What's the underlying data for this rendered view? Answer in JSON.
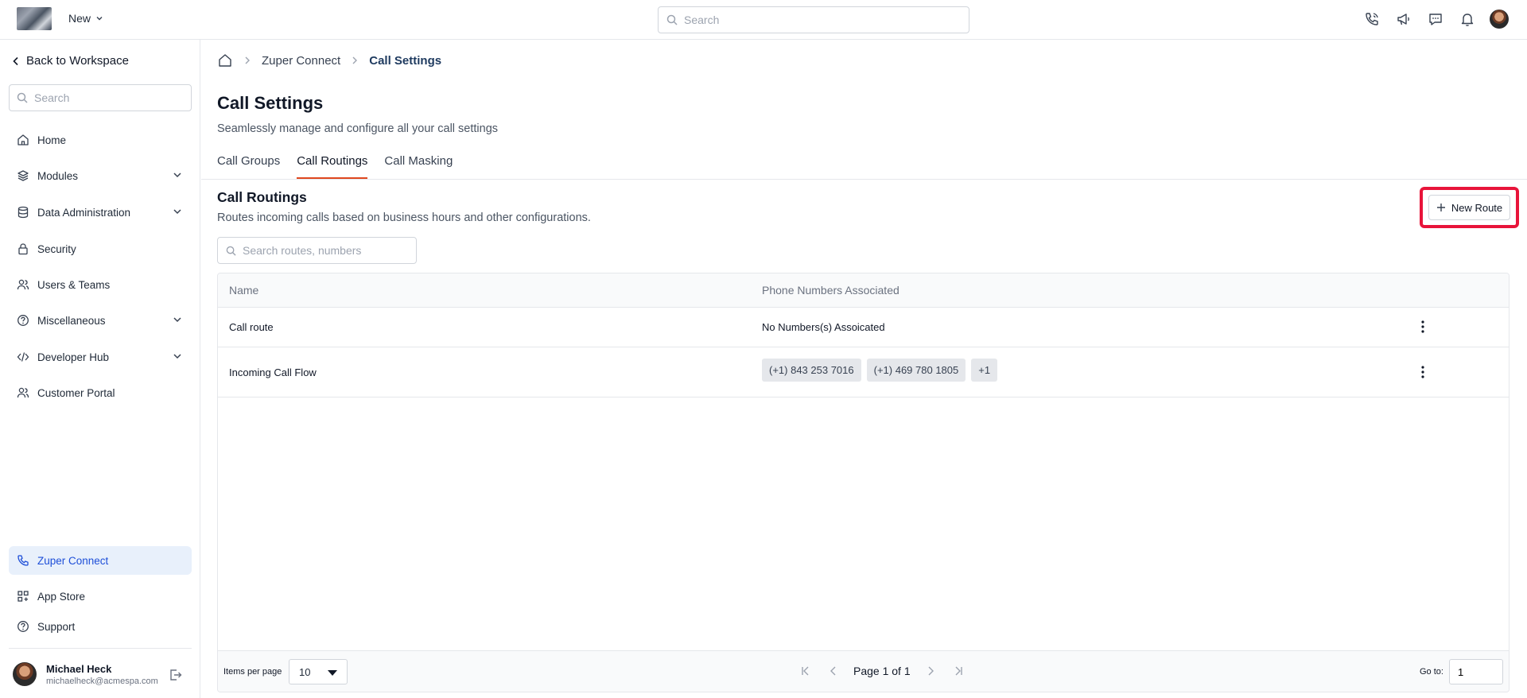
{
  "topbar": {
    "new_label": "New",
    "search_placeholder": "Search",
    "icons": [
      "phone-call-icon",
      "megaphone-icon",
      "chat-icon",
      "bell-icon",
      "user-avatar"
    ]
  },
  "sidebar": {
    "back_label": "Back to Workspace",
    "search_placeholder": "Search",
    "items": [
      {
        "label": "Home",
        "icon": "home-icon",
        "expandable": false
      },
      {
        "label": "Modules",
        "icon": "layers-icon",
        "expandable": true
      },
      {
        "label": "Data Administration",
        "icon": "database-icon",
        "expandable": true
      },
      {
        "label": "Security",
        "icon": "lock-icon",
        "expandable": false
      },
      {
        "label": "Users & Teams",
        "icon": "users-icon",
        "expandable": false
      },
      {
        "label": "Miscellaneous",
        "icon": "help-circle-icon",
        "expandable": true
      },
      {
        "label": "Developer Hub",
        "icon": "code-icon",
        "expandable": true
      },
      {
        "label": "Customer Portal",
        "icon": "users-icon",
        "expandable": false
      }
    ],
    "bottom_items": [
      {
        "label": "Zuper Connect",
        "icon": "phone-icon",
        "active": true
      },
      {
        "label": "App Store",
        "icon": "apps-icon",
        "active": false
      },
      {
        "label": "Support",
        "icon": "help-circle-icon",
        "active": false
      }
    ],
    "user": {
      "name": "Michael Heck",
      "email": "michaelheck@acmespa.com"
    }
  },
  "breadcrumb": {
    "items": [
      "Zuper Connect",
      "Call Settings"
    ]
  },
  "page": {
    "title": "Call Settings",
    "subtitle": "Seamlessly manage and configure all your call settings",
    "tabs": [
      {
        "label": "Call Groups",
        "active": false
      },
      {
        "label": "Call Routings",
        "active": true
      },
      {
        "label": "Call Masking",
        "active": false
      }
    ]
  },
  "section": {
    "title": "Call Routings",
    "subtitle": "Routes incoming calls based on business hours and other configurations.",
    "new_button_label": "New Route",
    "search_placeholder": "Search routes, numbers"
  },
  "table": {
    "columns": [
      "Name",
      "Phone Numbers Associated"
    ],
    "rows": [
      {
        "name": "Call route",
        "numbers_text": "No Numbers(s) Assoicated",
        "chips": []
      },
      {
        "name": "Incoming Call Flow",
        "numbers_text": "",
        "chips": [
          "(+1) 843 253 7016",
          "(+1) 469 780 1805",
          "+1"
        ]
      }
    ]
  },
  "pagination": {
    "items_per_page_label": "Items per page",
    "items_per_page": "10",
    "page_text": "Page 1 of 1",
    "goto_label": "Go to:",
    "goto_value": "1"
  },
  "colors": {
    "accent": "#e0481f",
    "highlight": "#e8143a",
    "active_nav_bg": "#e8f0fb",
    "active_nav_text": "#1d4ed8"
  }
}
